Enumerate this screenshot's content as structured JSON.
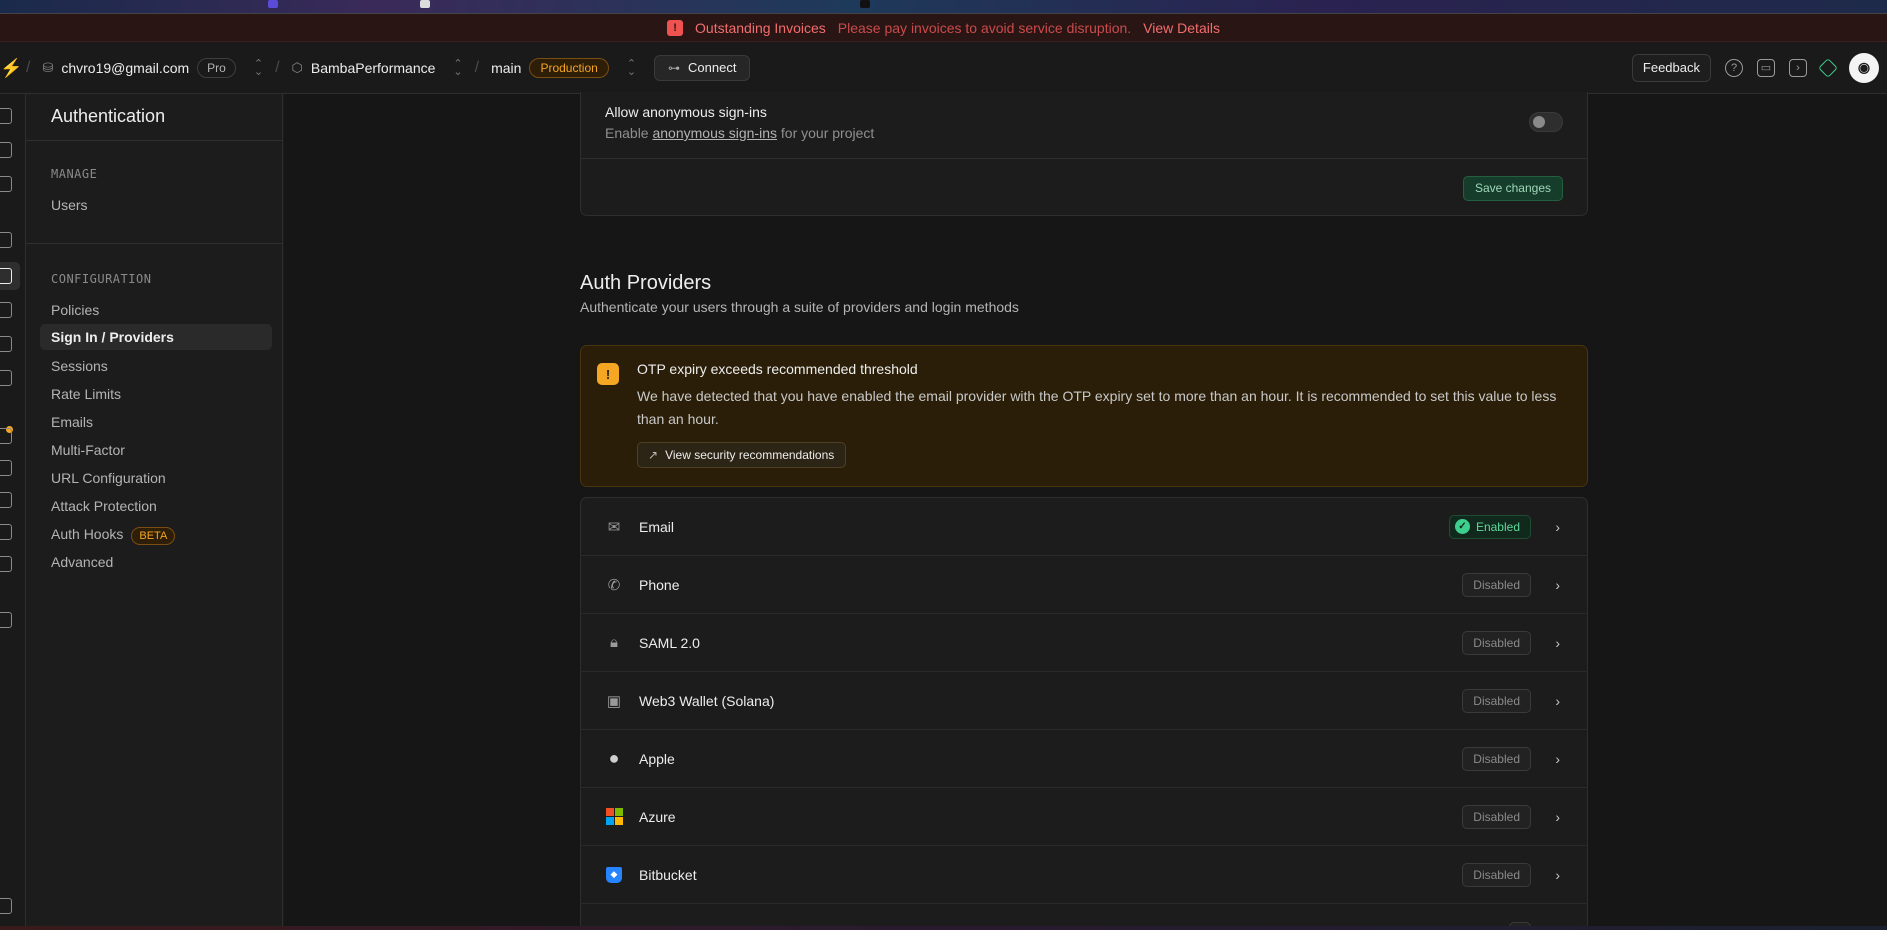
{
  "banner": {
    "title": "Outstanding Invoices",
    "message": "Please pay invoices to avoid service disruption.",
    "link": "View Details"
  },
  "topbar": {
    "account_email": "chvro19@gmail.com",
    "plan_badge": "Pro",
    "project_name": "BambaPerformance",
    "branch_name": "main",
    "environment_badge": "Production",
    "connect_label": "Connect",
    "feedback_label": "Feedback"
  },
  "sidenav": {
    "title": "Authentication",
    "manage_heading": "MANAGE",
    "manage_items": [
      "Users"
    ],
    "config_heading": "CONFIGURATION",
    "config_items": [
      "Policies",
      "Sign In / Providers",
      "Sessions",
      "Rate Limits",
      "Emails",
      "Multi-Factor",
      "URL Configuration",
      "Attack Protection",
      "Auth Hooks",
      "Advanced"
    ],
    "active_item": "Sign In / Providers",
    "beta_badge": "BETA"
  },
  "anonymous": {
    "title": "Allow anonymous sign-ins",
    "desc_prefix": "Enable",
    "desc_link": "anonymous sign-ins",
    "desc_suffix": "for your project",
    "enabled": false,
    "save_label": "Save changes"
  },
  "auth_providers": {
    "title": "Auth Providers",
    "description": "Authenticate your users through a suite of providers and login methods"
  },
  "alert": {
    "title": "OTP expiry exceeds recommended threshold",
    "message": "We have detected that you have enabled the email provider with the OTP expiry set to more than an hour. It is recommended to set this value to less than an hour.",
    "button_label": "View security recommendations"
  },
  "providers": [
    {
      "name": "Email",
      "status": "Enabled",
      "icon": "mail-icon"
    },
    {
      "name": "Phone",
      "status": "Disabled",
      "icon": "phone-icon"
    },
    {
      "name": "SAML 2.0",
      "status": "Disabled",
      "icon": "lock-icon"
    },
    {
      "name": "Web3 Wallet (Solana)",
      "status": "Disabled",
      "icon": "wallet-icon"
    },
    {
      "name": "Apple",
      "status": "Disabled",
      "icon": "apple-icon"
    },
    {
      "name": "Azure",
      "status": "Disabled",
      "icon": "azure-icon"
    },
    {
      "name": "Bitbucket",
      "status": "Disabled",
      "icon": "bitbucket-icon"
    }
  ],
  "colors": {
    "brand": "#3ecf8e",
    "warning": "#f5a623",
    "danger": "#f26d6d",
    "background": "#161616"
  }
}
